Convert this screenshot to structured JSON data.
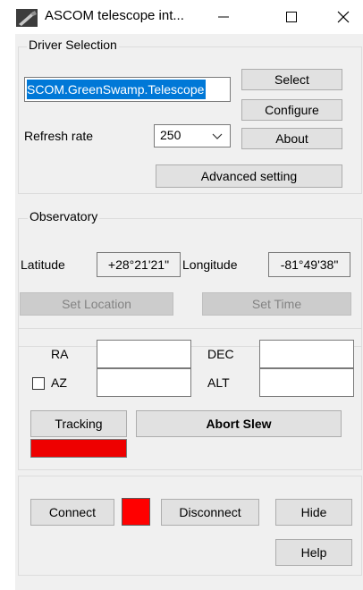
{
  "window": {
    "title": "ASCOM telescope int...",
    "minimize_glyph": "—",
    "maximize_glyph": "☐",
    "close_glyph": "✕",
    "app_icon": "telescope-icon"
  },
  "driver_selection": {
    "legend": "Driver Selection",
    "driver_id": "SCOM.GreenSwamp.Telescope",
    "select_label": "Select",
    "configure_label": "Configure",
    "about_label": "About",
    "refresh_rate_label": "Refresh rate",
    "refresh_rate_value": "250",
    "advanced_label": "Advanced setting"
  },
  "observatory": {
    "legend": "Observatory",
    "latitude_label": "Latitude",
    "latitude_value": "+28°21'21\"",
    "longitude_label": "Longitude",
    "longitude_value": "-81°49'38\"",
    "set_location_label": "Set Location",
    "set_time_label": "Set Time"
  },
  "position": {
    "ra_label": "RA",
    "dec_label": "DEC",
    "az_label": "AZ",
    "alt_label": "ALT",
    "az_checked": false,
    "tracking_label": "Tracking",
    "abort_label": "Abort Slew",
    "tracking_status_color": "#ee0000"
  },
  "connection": {
    "connect_label": "Connect",
    "disconnect_label": "Disconnect",
    "hide_label": "Hide",
    "help_label": "Help",
    "status_color": "#ff0000"
  }
}
